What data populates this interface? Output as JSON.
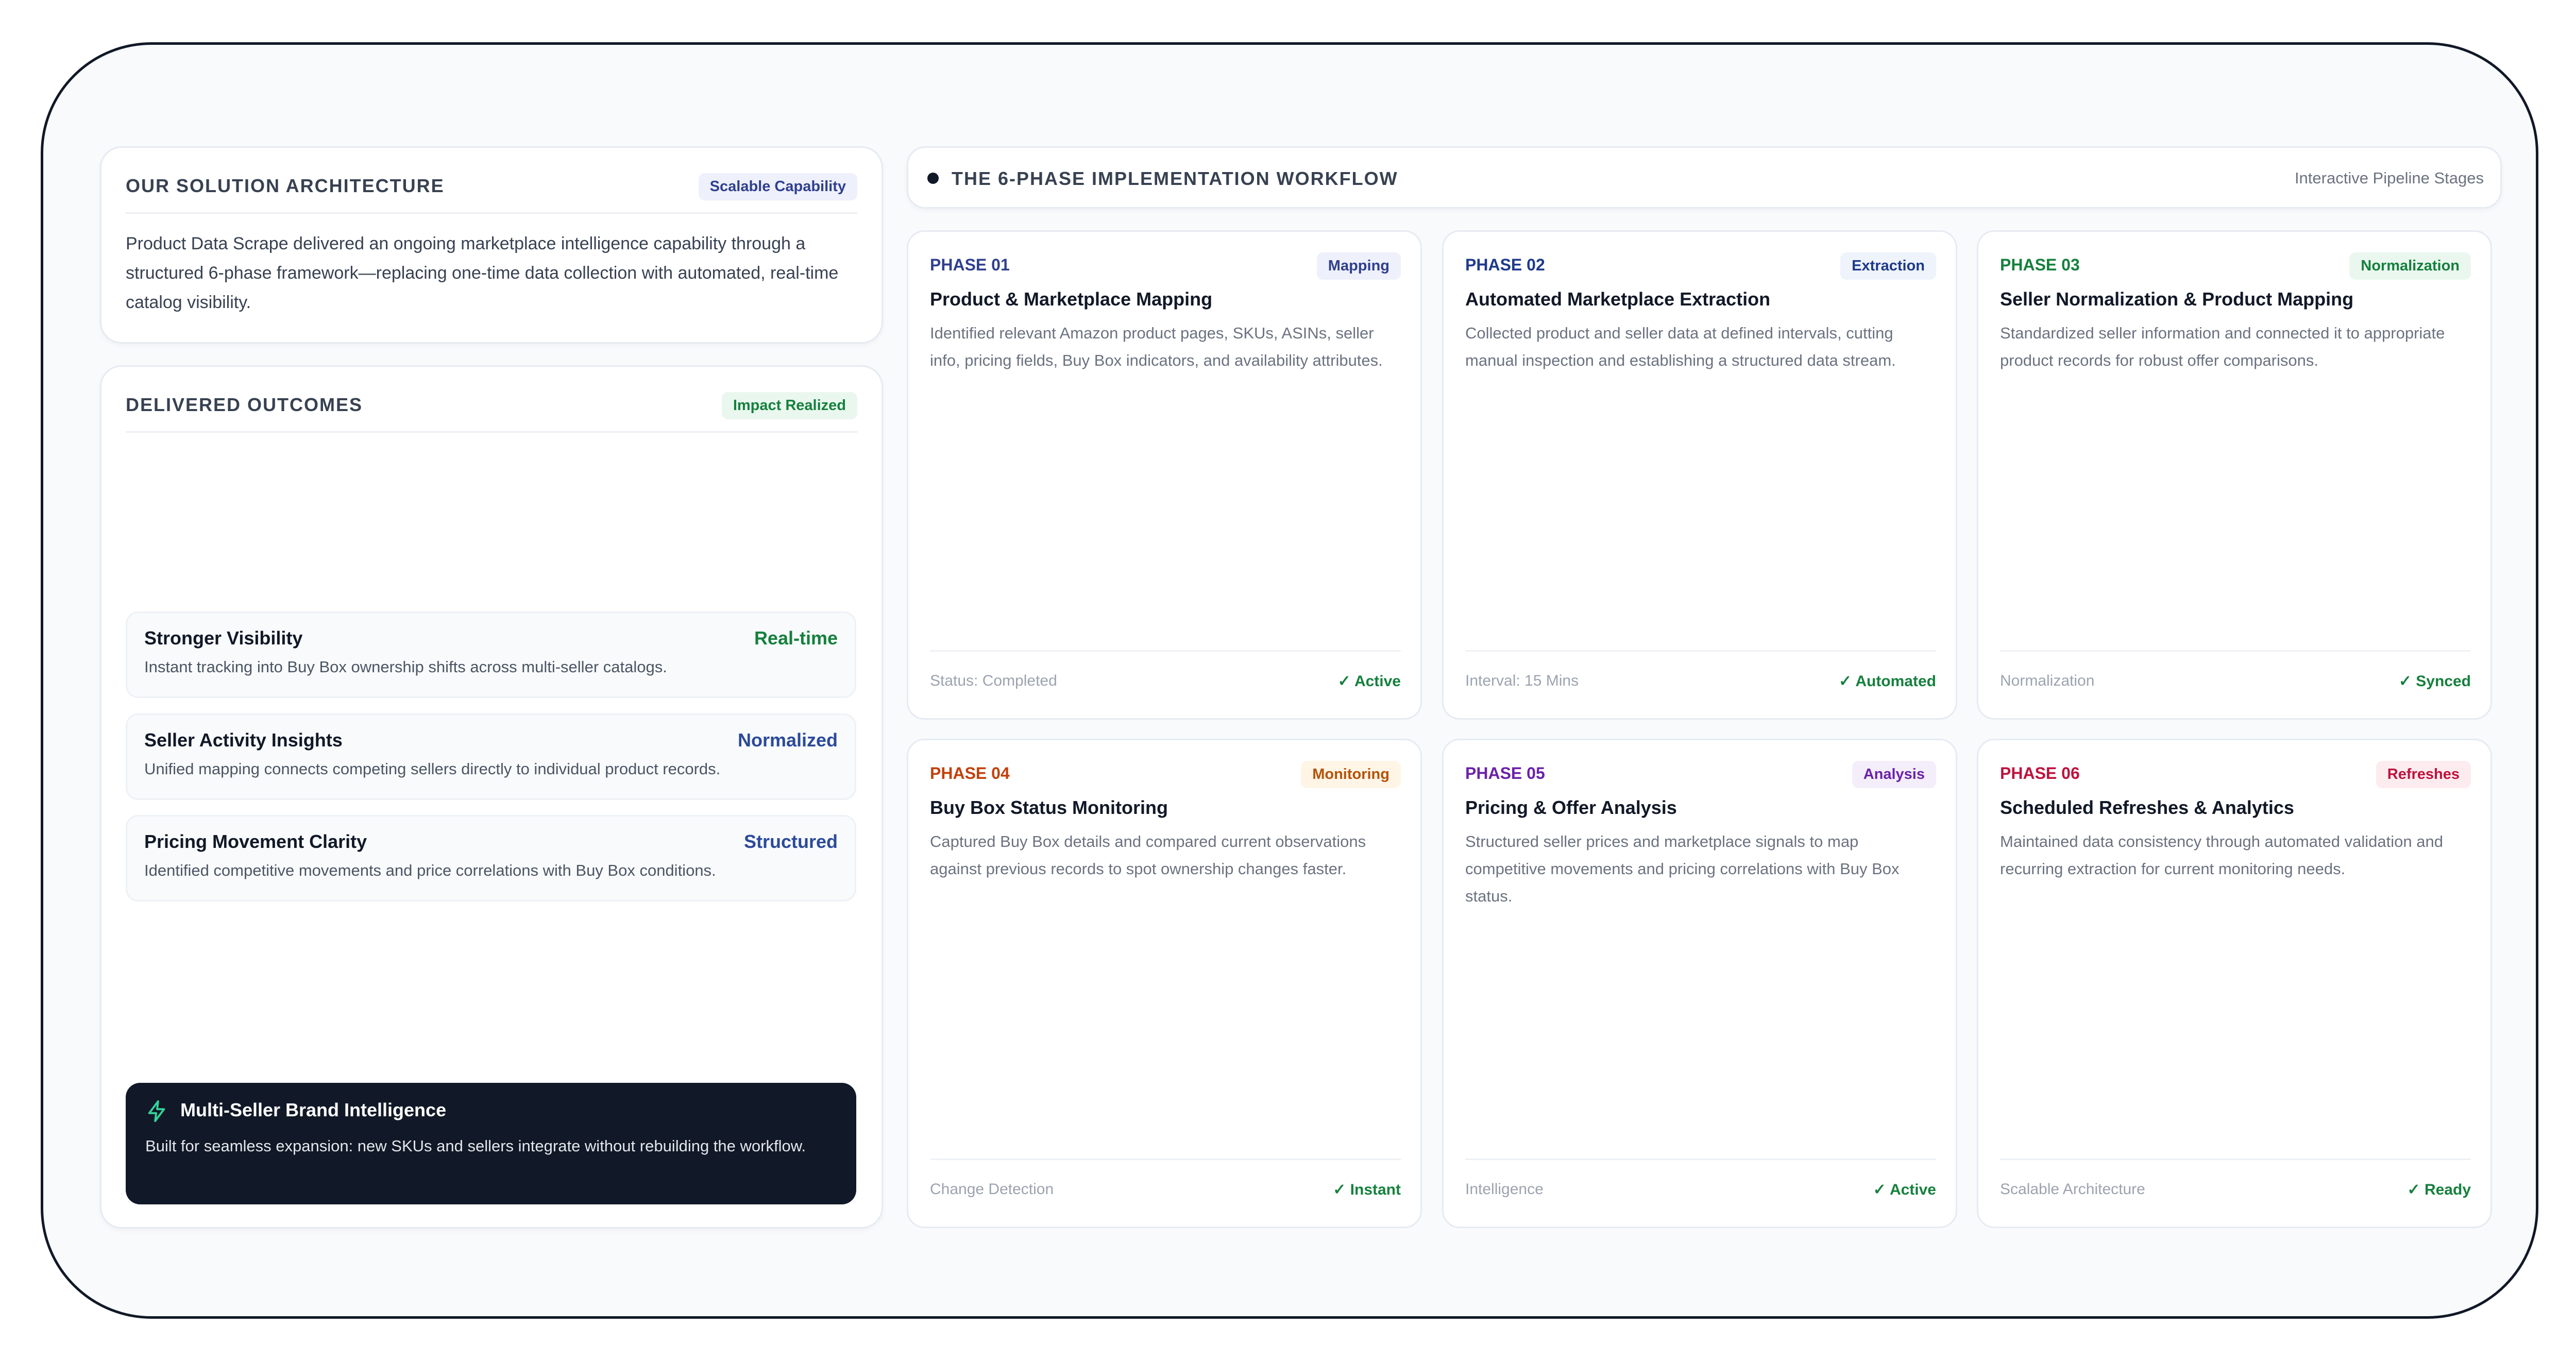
{
  "architecture": {
    "title": "OUR SOLUTION ARCHITECTURE",
    "badge": "Scalable Capability",
    "description": "Product Data Scrape delivered an ongoing marketplace intelligence capability through a structured 6-phase framework—replacing one-time data collection with automated, real-time catalog visibility."
  },
  "outcomes": {
    "title": "DELIVERED OUTCOMES",
    "badge": "Impact Realized",
    "items": [
      {
        "title": "Stronger Visibility",
        "value": "Real-time",
        "value_color": "#15803d",
        "description": "Instant tracking into Buy Box ownership shifts across multi-seller catalogs."
      },
      {
        "title": "Seller Activity Insights",
        "value": "Normalized",
        "value_color": "#2c4a9a",
        "description": "Unified mapping connects competing sellers directly to individual product records."
      },
      {
        "title": "Pricing Movement Clarity",
        "value": "Structured",
        "value_color": "#2c4a9a",
        "description": "Identified competitive movements and price correlations with Buy Box conditions."
      }
    ],
    "brand": {
      "icon": "lightning-icon",
      "title": "Multi-Seller Brand Intelligence",
      "description": "Built for seamless expansion: new SKUs and sellers integrate without rebuilding the workflow."
    }
  },
  "workflow": {
    "title": "THE 6-PHASE IMPLEMENTATION WORKFLOW",
    "subtitle": "Interactive Pipeline Stages",
    "phases": [
      {
        "label": "PHASE 01",
        "label_color": "#2f3f8f",
        "badge": "Mapping",
        "title": "Product & Marketplace Mapping",
        "description": "Identified relevant Amazon product pages, SKUs, ASINs, seller info, pricing fields, Buy Box indicators, and availability attributes.",
        "footer_left": "Status: Completed",
        "footer_right": "✓ Active"
      },
      {
        "label": "PHASE 02",
        "label_color": "#1e3a8a",
        "badge": "Extraction",
        "title": "Automated Marketplace Extraction",
        "description": "Collected product and seller data at defined intervals, cutting manual inspection and establishing a structured data stream.",
        "footer_left": "Interval: 15 Mins",
        "footer_right": "✓ Automated"
      },
      {
        "label": "PHASE 03",
        "label_color": "#15803d",
        "badge": "Normalization",
        "title": "Seller Normalization & Product Mapping",
        "description": "Standardized seller information and connected it to appropriate product records for robust offer comparisons.",
        "footer_left": "Normalization",
        "footer_right": "✓ Synced"
      },
      {
        "label": "PHASE 04",
        "label_color": "#c2410c",
        "badge": "Monitoring",
        "title": "Buy Box Status Monitoring",
        "description": "Captured Buy Box details and compared current observations against previous records to spot ownership changes faster.",
        "footer_left": "Change Detection",
        "footer_right": "✓ Instant"
      },
      {
        "label": "PHASE 05",
        "label_color": "#6b21a8",
        "badge": "Analysis",
        "title": "Pricing & Offer Analysis",
        "description": "Structured seller prices and marketplace signals to map competitive movements and pricing correlations with Buy Box status.",
        "footer_left": "Intelligence",
        "footer_right": "✓ Active"
      },
      {
        "label": "PHASE 06",
        "label_color": "#be123c",
        "badge": "Refreshes",
        "title": "Scheduled Refreshes & Analytics",
        "description": "Maintained data consistency through automated validation and recurring extraction for current monitoring needs.",
        "footer_left": "Scalable Architecture",
        "footer_right": "✓ Ready"
      }
    ]
  }
}
